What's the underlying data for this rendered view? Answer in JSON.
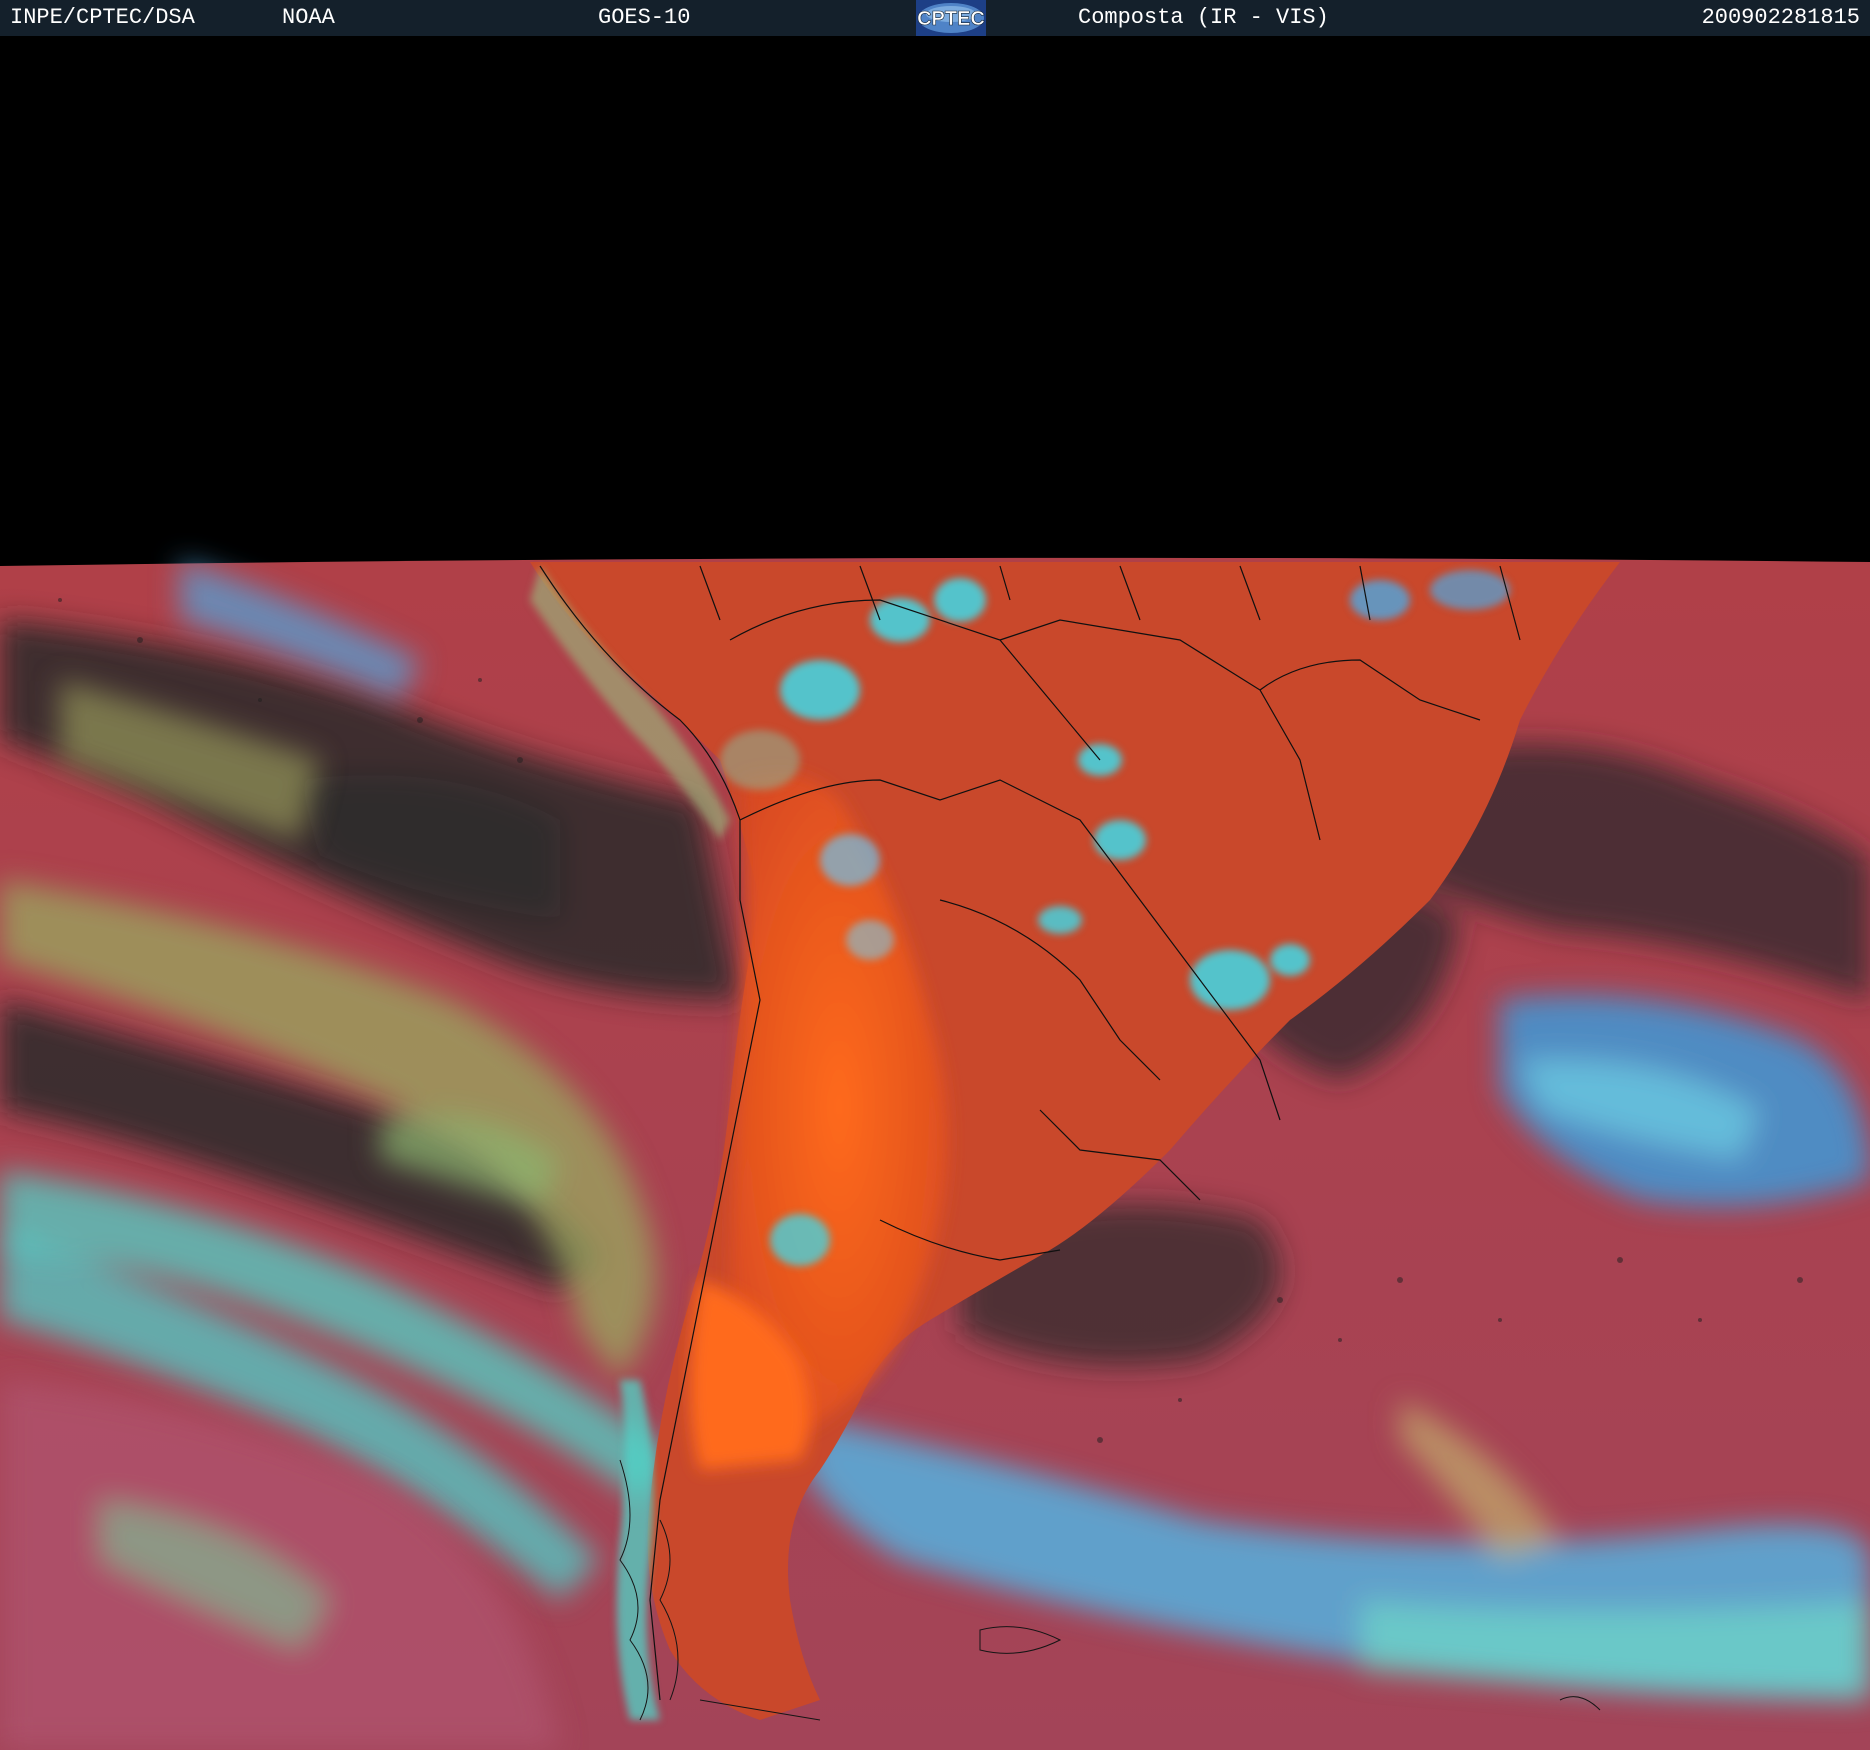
{
  "header": {
    "agency": "INPE/CPTEC/DSA",
    "source": "NOAA",
    "satellite": "GOES-10",
    "product": "Composta (IR - VIS)",
    "timestamp": "200902281815",
    "logo_text": "CPTEC"
  },
  "colors": {
    "header_bg": "#14202b",
    "land_warm": "#e85a20",
    "ocean_base": "#a9414e",
    "cloud_cyan": "#3fd9e8",
    "clear_dark": "#2a2a2a"
  }
}
